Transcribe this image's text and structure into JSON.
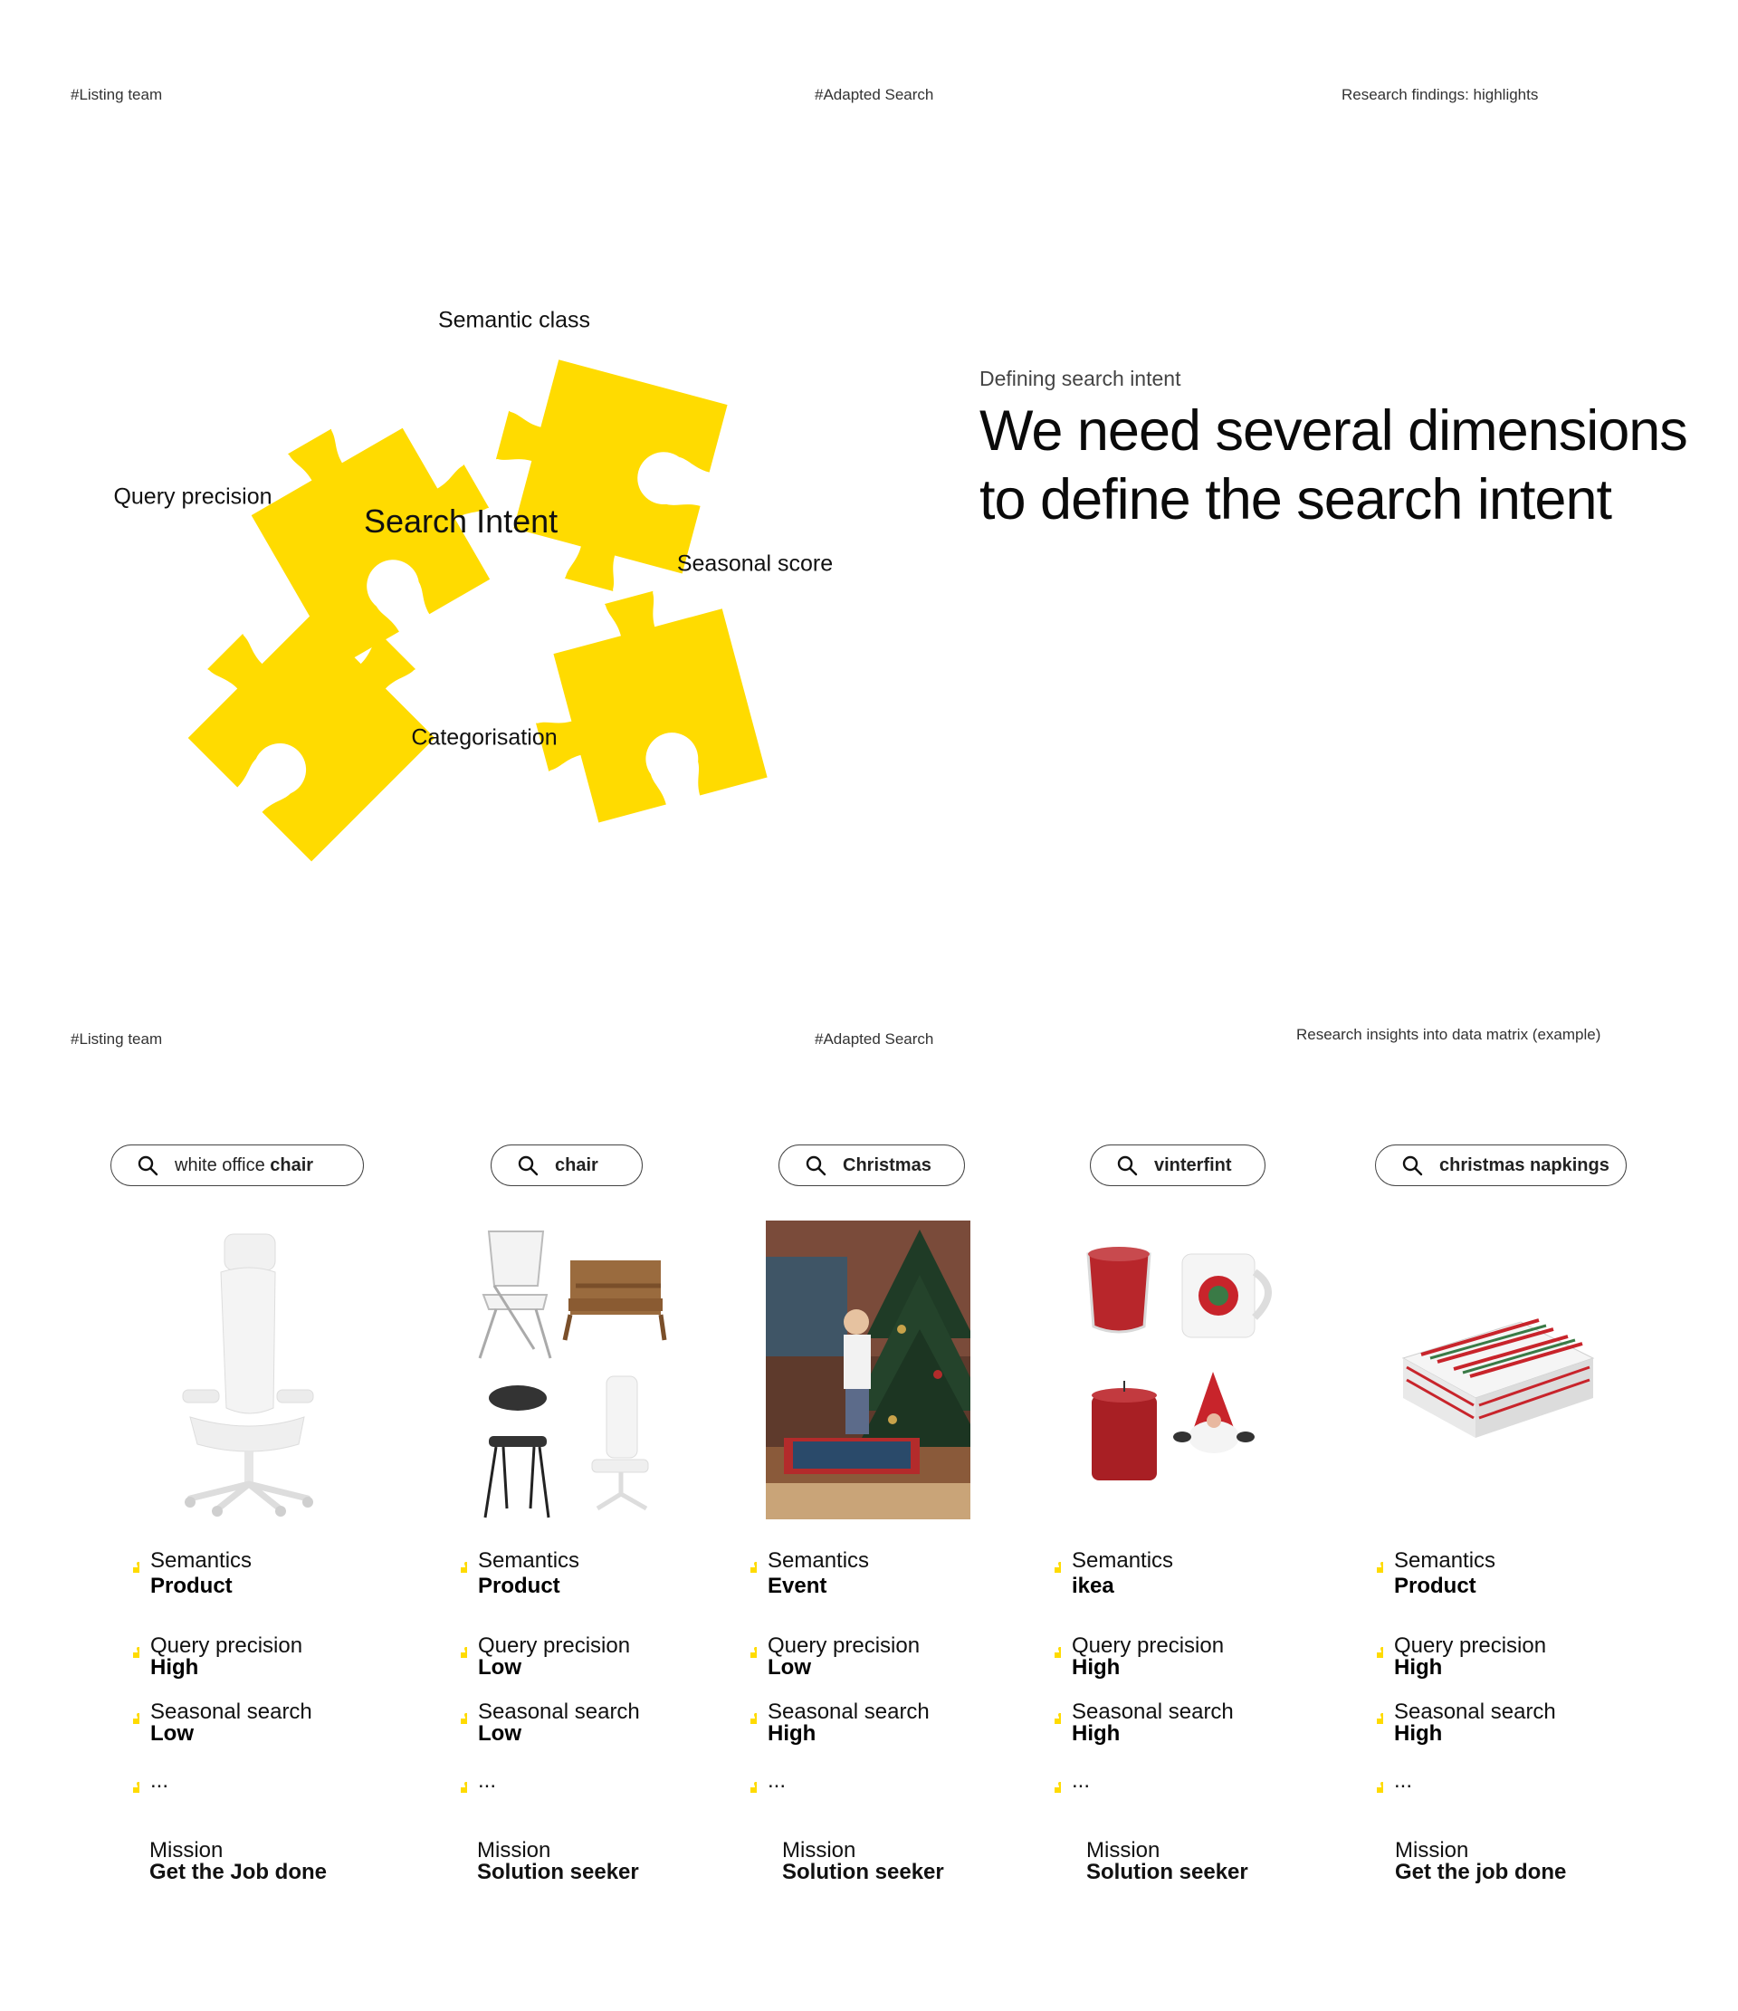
{
  "slide1": {
    "header_left": "#Listing team",
    "header_center": "#Adapted Search",
    "header_right": "Research findings: highlights",
    "pieces": [
      "Semantic class",
      "Query precision",
      "Seasonal score",
      "Categorisation"
    ],
    "center_label": "Search Intent",
    "kicker": "Defining search intent",
    "headline_line1": "We need several dimensions",
    "headline_line2": "to define the search intent",
    "puzzle_color": "#FFDB00"
  },
  "slide2": {
    "header_left": "#Listing team",
    "header_center": "#Adapted Search",
    "header_right": "Research insights into data matrix (example)",
    "columns": [
      {
        "query_light": "white office",
        "query_bold": "chair",
        "semantics_label": "Semantics",
        "semantics_value": "Product",
        "precision_label": "Query precision",
        "precision_value": "High",
        "seasonal_label": "Seasonal search",
        "seasonal_value": "Low",
        "more": "...",
        "mission_label": "Mission",
        "mission_value": "Get the Job done"
      },
      {
        "query_light": "",
        "query_bold": "chair",
        "semantics_label": "Semantics",
        "semantics_value": "Product",
        "precision_label": "Query precision",
        "precision_value": "Low",
        "seasonal_label": "Seasonal search",
        "seasonal_value": "Low",
        "more": "...",
        "mission_label": "Mission",
        "mission_value": "Solution seeker"
      },
      {
        "query_light": "",
        "query_bold": "Christmas",
        "semantics_label": "Semantics",
        "semantics_value": "Event",
        "precision_label": "Query precision",
        "precision_value": "Low",
        "seasonal_label": "Seasonal search",
        "seasonal_value": "High",
        "more": "...",
        "mission_label": "Mission",
        "mission_value": "Solution seeker"
      },
      {
        "query_light": "",
        "query_bold": "vinterfint",
        "semantics_label": "Semantics",
        "semantics_value": "ikea",
        "precision_label": "Query precision",
        "precision_value": "High",
        "seasonal_label": "Seasonal search",
        "seasonal_value": "High",
        "more": "...",
        "mission_label": "Mission",
        "mission_value": "Solution seeker"
      },
      {
        "query_light": "",
        "query_bold": "christmas napkings",
        "semantics_label": "Semantics",
        "semantics_value": "Product",
        "precision_label": "Query precision",
        "precision_value": "High",
        "seasonal_label": "Seasonal search",
        "seasonal_value": "High",
        "more": "...",
        "mission_label": "Mission",
        "mission_value": "Get the job done"
      }
    ]
  },
  "icons": {
    "search": "search-icon",
    "puzzle": "puzzle-piece-icon"
  }
}
